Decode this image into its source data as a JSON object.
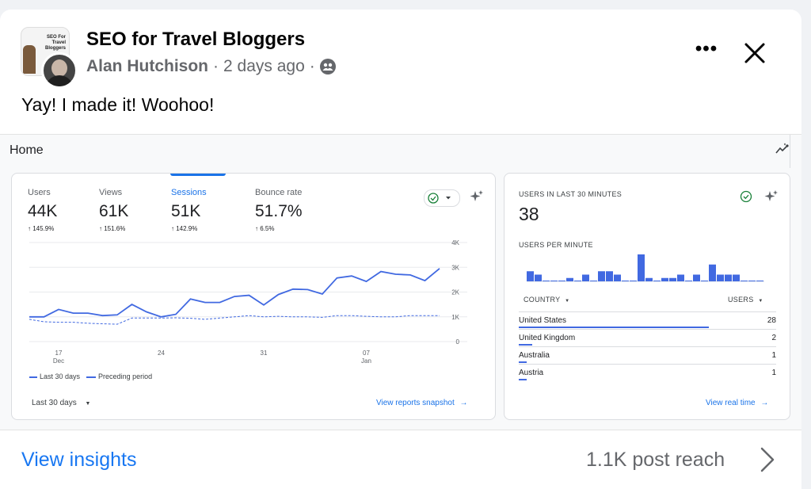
{
  "post": {
    "group_name": "SEO for Travel Bloggers",
    "author": "Alan Hutchison",
    "separator": "·",
    "time": "2 days ago",
    "group_thumb_text": "SEO For Travel Bloggers",
    "text": "Yay! I made it! Woohoo!"
  },
  "analytics": {
    "page_label": "Home",
    "metrics": [
      {
        "label": "Users",
        "value": "44K",
        "change": "↑ 145.9%"
      },
      {
        "label": "Views",
        "value": "61K",
        "change": "↑ 151.6%"
      },
      {
        "label": "Sessions",
        "value": "51K",
        "change": "↑ 142.9%"
      },
      {
        "label": "Bounce rate",
        "value": "51.7%",
        "change": "↑ 6.5%"
      }
    ],
    "legend": {
      "current": "Last 30 days",
      "previous": "Preceding period"
    },
    "date_range": "Last 30 days",
    "view_snapshot": "View reports snapshot",
    "realtime": {
      "title": "USERS IN LAST 30 MINUTES",
      "value": "38",
      "per_minute_label": "USERS PER MINUTE",
      "col_country": "COUNTRY",
      "col_users": "USERS",
      "per_minute": [
        3,
        2,
        0,
        0,
        0,
        1,
        0,
        2,
        0,
        3,
        3,
        2,
        0,
        0,
        8,
        1,
        0,
        1,
        1,
        2,
        0,
        2,
        0,
        5,
        2,
        2,
        2,
        0,
        0,
        0
      ],
      "rows": [
        {
          "country": "United States",
          "users": "28",
          "share": 0.857
        },
        {
          "country": "United Kingdom",
          "users": "2",
          "share": 0.06
        },
        {
          "country": "Australia",
          "users": "1",
          "share": 0.03
        },
        {
          "country": "Austria",
          "users": "1",
          "share": 0.03
        }
      ],
      "view_realtime": "View real time"
    },
    "colors": {
      "accent": "#1a73e8",
      "series": "#4169e1"
    }
  },
  "chart_data": {
    "type": "line",
    "title": "",
    "xlabel": "",
    "ylabel": "",
    "ylim": [
      0,
      4000
    ],
    "y_ticks": [
      "4K",
      "3K",
      "2K",
      "1K",
      "0"
    ],
    "x_ticks": [
      {
        "label": "17",
        "sub": "Dec",
        "index": 2
      },
      {
        "label": "24",
        "sub": "",
        "index": 9
      },
      {
        "label": "31",
        "sub": "",
        "index": 16
      },
      {
        "label": "07",
        "sub": "Jan",
        "index": 23
      }
    ],
    "series": [
      {
        "name": "Last 30 days",
        "style": "solid",
        "values": [
          1000,
          1000,
          1300,
          1150,
          1150,
          1050,
          1080,
          1500,
          1200,
          1000,
          1100,
          1720,
          1580,
          1580,
          1820,
          1870,
          1480,
          1900,
          2120,
          2100,
          1920,
          2570,
          2650,
          2430,
          2830,
          2720,
          2690,
          2460,
          2950
        ]
      },
      {
        "name": "Preceding period",
        "style": "dashed",
        "values": [
          900,
          800,
          780,
          780,
          740,
          720,
          700,
          950,
          950,
          950,
          960,
          940,
          900,
          950,
          1000,
          1050,
          1000,
          1020,
          1000,
          1000,
          980,
          1050,
          1050,
          1020,
          1000,
          1000,
          1050,
          1050,
          1050
        ]
      }
    ]
  },
  "footer": {
    "view_insights": "View insights",
    "post_reach": "1.1K post reach"
  }
}
